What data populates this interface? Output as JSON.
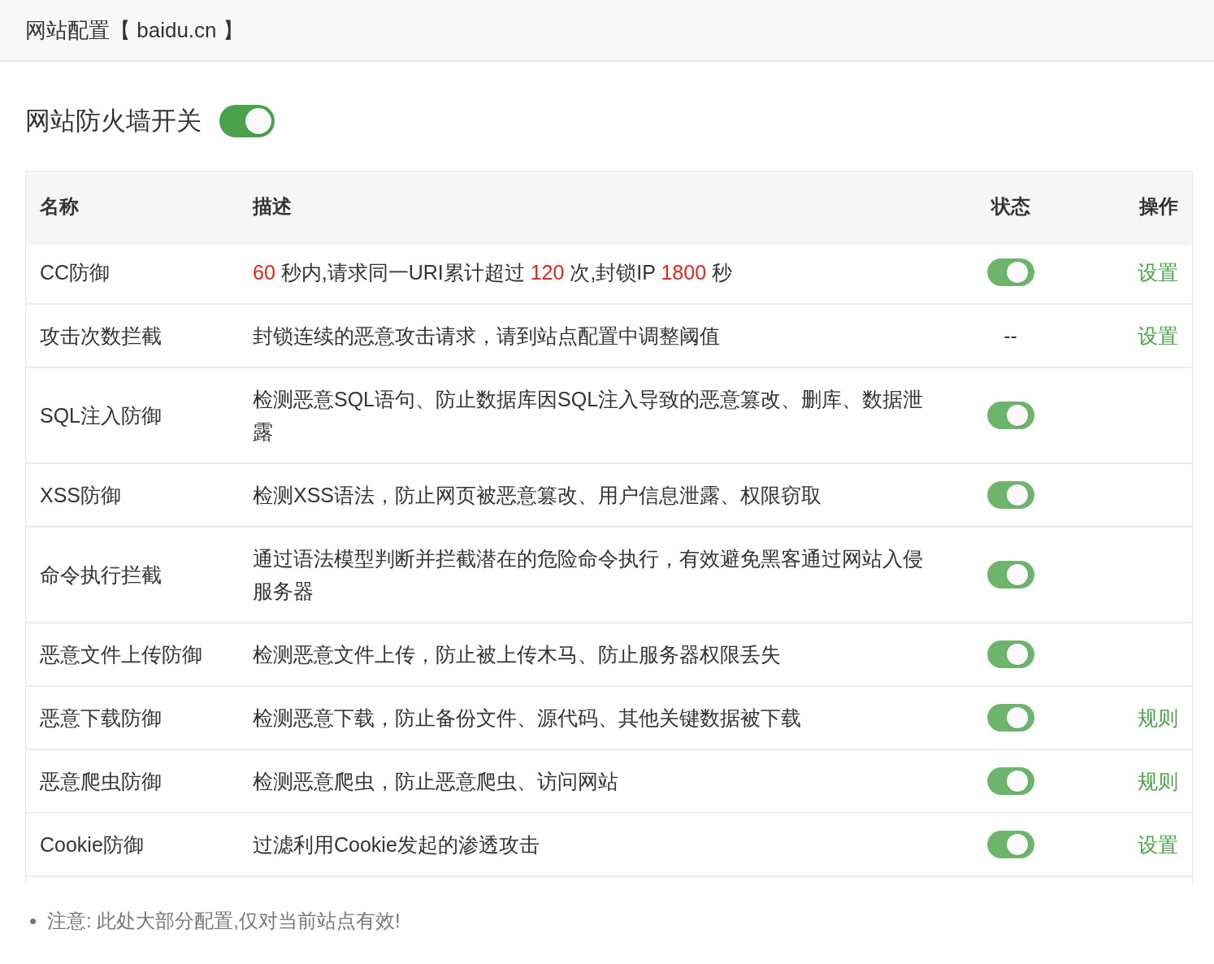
{
  "window": {
    "title": "网站配置【 baidu.cn 】"
  },
  "master_switch": {
    "label": "网站防火墙开关",
    "on": true
  },
  "table": {
    "columns": [
      "名称",
      "描述",
      "状态",
      "操作"
    ],
    "rows": [
      {
        "name": "CC防御",
        "description": [
          {
            "text": "60",
            "highlight": true
          },
          {
            "text": " 秒内,请求同一URI累计超过 ",
            "highlight": false
          },
          {
            "text": "120",
            "highlight": true
          },
          {
            "text": " 次,封锁IP ",
            "highlight": false
          },
          {
            "text": "1800",
            "highlight": true
          },
          {
            "text": " 秒",
            "highlight": false
          }
        ],
        "status": {
          "kind": "toggle",
          "on": true
        },
        "action": "设置"
      },
      {
        "name": "攻击次数拦截",
        "description": [
          {
            "text": "封锁连续的恶意攻击请求，请到站点配置中调整阈值",
            "highlight": false
          }
        ],
        "status": {
          "kind": "text",
          "text": "--"
        },
        "action": "设置"
      },
      {
        "name": "SQL注入防御",
        "description": [
          {
            "text": "检测恶意SQL语句、防止数据库因SQL注入导致的恶意篡改、删库、数据泄露",
            "highlight": false
          }
        ],
        "status": {
          "kind": "toggle",
          "on": true
        }
      },
      {
        "name": "XSS防御",
        "description": [
          {
            "text": "检测XSS语法，防止网页被恶意篡改、用户信息泄露、权限窃取",
            "highlight": false
          }
        ],
        "status": {
          "kind": "toggle",
          "on": true
        }
      },
      {
        "name": "命令执行拦截",
        "description": [
          {
            "text": "通过语法模型判断并拦截潜在的危险命令执行，有效避免黑客通过网站入侵服务器",
            "highlight": false
          }
        ],
        "status": {
          "kind": "toggle",
          "on": true
        }
      },
      {
        "name": "恶意文件上传防御",
        "description": [
          {
            "text": "检测恶意文件上传，防止被上传木马、防止服务器权限丢失",
            "highlight": false
          }
        ],
        "status": {
          "kind": "toggle",
          "on": true
        }
      },
      {
        "name": "恶意下载防御",
        "description": [
          {
            "text": "检测恶意下载，防止备份文件、源代码、其他关键数据被下载",
            "highlight": false
          }
        ],
        "status": {
          "kind": "toggle",
          "on": true
        },
        "action": "规则"
      },
      {
        "name": "恶意爬虫防御",
        "description": [
          {
            "text": "检测恶意爬虫，防止恶意爬虫、访问网站",
            "highlight": false
          }
        ],
        "status": {
          "kind": "toggle",
          "on": true
        },
        "action": "规则"
      },
      {
        "name": "Cookie防御",
        "description": [
          {
            "text": "过滤利用Cookie发起的渗透攻击",
            "highlight": false
          }
        ],
        "status": {
          "kind": "toggle",
          "on": true
        },
        "action": "设置"
      }
    ]
  },
  "notes": [
    "注意: 此处大部分配置,仅对当前站点有效!"
  ]
}
